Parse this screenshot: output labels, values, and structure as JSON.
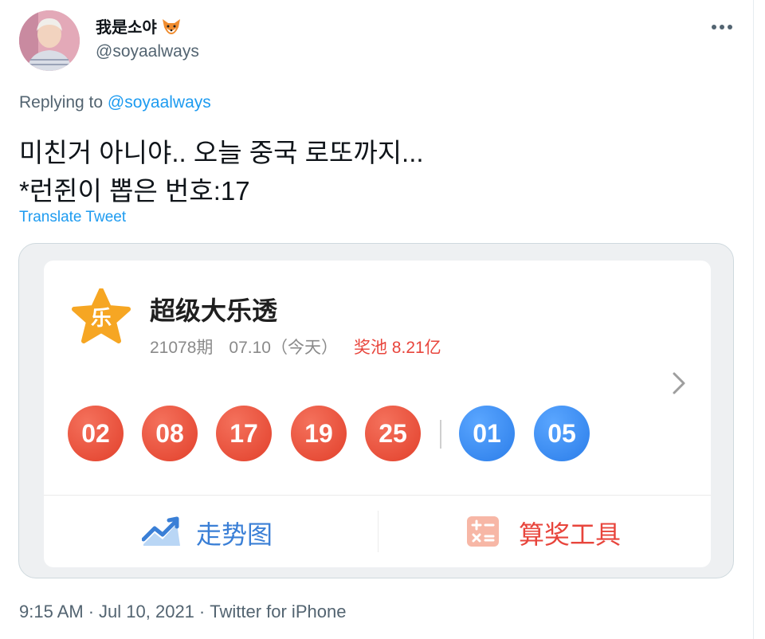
{
  "author": {
    "display_name": "我是소야",
    "handle": "@soyaalways",
    "avatar_icon": "avatar-photo",
    "emoji_icon": "fox-face-icon"
  },
  "reply": {
    "prefix": "Replying to",
    "mention": "@soyaalways"
  },
  "tweet": {
    "text_line1": "미친거 아니야.. 오늘 중국 로또까지...",
    "text_line2": "*런쥔이 뽑은 번호:17",
    "translate_label": "Translate Tweet"
  },
  "media": {
    "lottery_name": "超级大乐透",
    "logo_char": "乐",
    "draw_number": "21078期",
    "draw_date": "07.10（今天）",
    "jackpot": "奖池 8.21亿",
    "red_balls": [
      "02",
      "08",
      "17",
      "19",
      "25"
    ],
    "blue_balls": [
      "01",
      "05"
    ],
    "trend_label": "走势图",
    "calc_label": "算奖工具",
    "colors": {
      "red": "#e8453c",
      "blue": "#2b7de9",
      "logo": "#f6a623"
    }
  },
  "meta": {
    "time": "9:15 AM",
    "date": "Jul 10, 2021",
    "source": "Twitter for iPhone"
  },
  "colors": {
    "link": "#1d9bf0",
    "secondary_text": "#536471"
  }
}
